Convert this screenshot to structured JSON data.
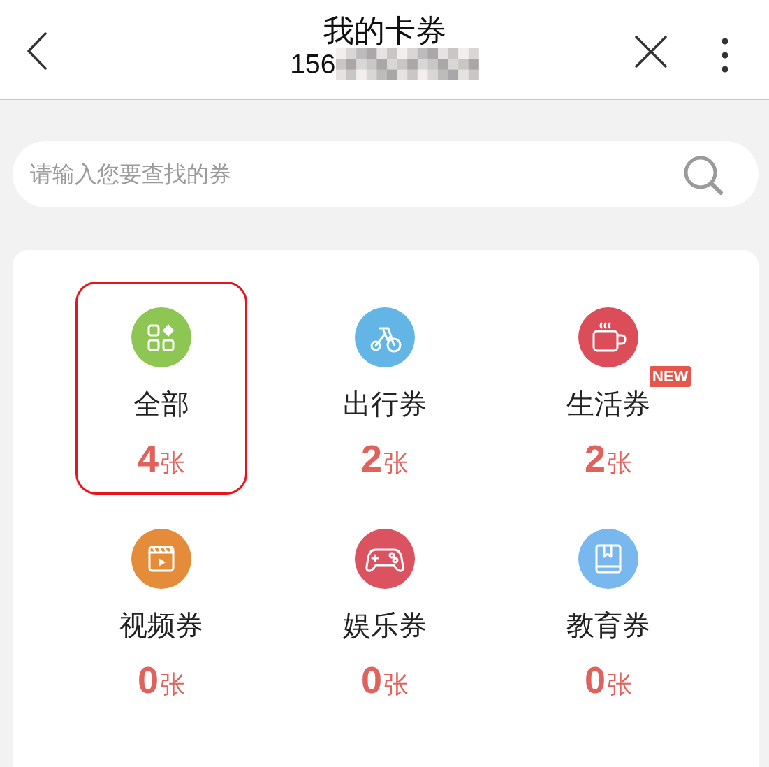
{
  "header": {
    "title": "我的卡券",
    "subtitle": "156",
    "subtitle_masked": true
  },
  "search": {
    "placeholder": "请输入您要查找的券"
  },
  "categories": [
    {
      "kind": "all",
      "label": "全部",
      "count": "4",
      "unit": "张",
      "color": "#8dc653",
      "highlighted": true
    },
    {
      "kind": "bike",
      "label": "出行券",
      "count": "2",
      "unit": "张",
      "color": "#63b5e5",
      "highlighted": false
    },
    {
      "kind": "cup",
      "label": "生活券",
      "count": "2",
      "unit": "张",
      "color": "#db4d59",
      "highlighted": false,
      "badge": "NEW"
    },
    {
      "kind": "video",
      "label": "视频券",
      "count": "0",
      "unit": "张",
      "color": "#e58c3a",
      "highlighted": false
    },
    {
      "kind": "gamepad",
      "label": "娱乐券",
      "count": "0",
      "unit": "张",
      "color": "#db5260",
      "highlighted": false
    },
    {
      "kind": "book",
      "label": "教育券",
      "count": "0",
      "unit": "张",
      "color": "#78b8ee",
      "highlighted": false
    }
  ]
}
